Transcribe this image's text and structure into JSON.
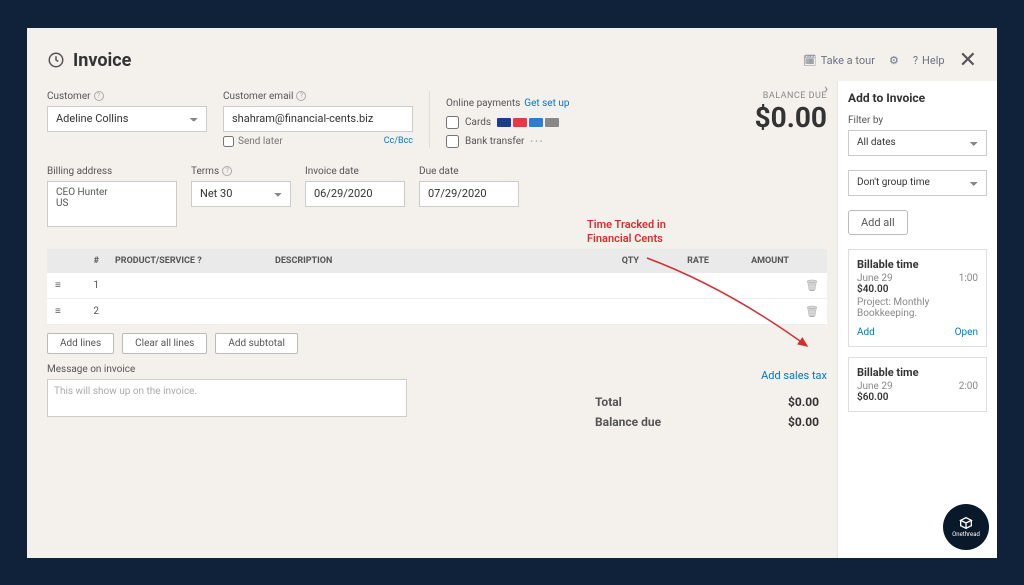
{
  "header": {
    "title": "Invoice",
    "take_tour": "Take a tour",
    "help": "Help"
  },
  "customer": {
    "label": "Customer",
    "value": "Adeline Collins",
    "email_label": "Customer email",
    "email": "shahram@financial-cents.biz",
    "send_later": "Send later",
    "cc_bcc": "Cc/Bcc"
  },
  "online": {
    "title": "Online payments",
    "setup": "Get set up",
    "cards": "Cards",
    "bank": "Bank transfer"
  },
  "balance": {
    "label": "BALANCE DUE",
    "value": "$0.00"
  },
  "billing": {
    "label": "Billing address",
    "value": "CEO Hunter\nUS"
  },
  "terms": {
    "label": "Terms",
    "value": "Net 30"
  },
  "dates": {
    "invoice_label": "Invoice date",
    "invoice": "06/29/2020",
    "due_label": "Due date",
    "due": "07/29/2020"
  },
  "table": {
    "cols": {
      "num": "#",
      "prod": "PRODUCT/SERVICE",
      "desc": "DESCRIPTION",
      "qty": "QTY",
      "rate": "RATE",
      "amt": "AMOUNT"
    },
    "rows": [
      {
        "n": "1"
      },
      {
        "n": "2"
      }
    ]
  },
  "buttons": {
    "add_lines": "Add lines",
    "clear_lines": "Clear all lines",
    "add_subtotal": "Add subtotal"
  },
  "message": {
    "label": "Message on invoice",
    "placeholder": "This will show up on the invoice."
  },
  "totals": {
    "sales_tax": "Add sales tax",
    "total_l": "Total",
    "total_v": "$0.00",
    "bal_l": "Balance due",
    "bal_v": "$0.00"
  },
  "annotation": "Time Tracked in\nFinancial Cents",
  "side": {
    "title": "Add to Invoice",
    "filter_label": "Filter by",
    "filter": "All dates",
    "group": "Don't group time",
    "add_all": "Add all",
    "items": [
      {
        "title": "Billable time",
        "date": "June 29",
        "hours": "1:00",
        "amount": "$40.00",
        "project": "Project: Monthly Bookkeeping.",
        "add": "Add",
        "open": "Open"
      },
      {
        "title": "Billable time",
        "date": "June 29",
        "hours": "2:00",
        "amount": "$60.00"
      }
    ]
  },
  "logo": "Onethread"
}
